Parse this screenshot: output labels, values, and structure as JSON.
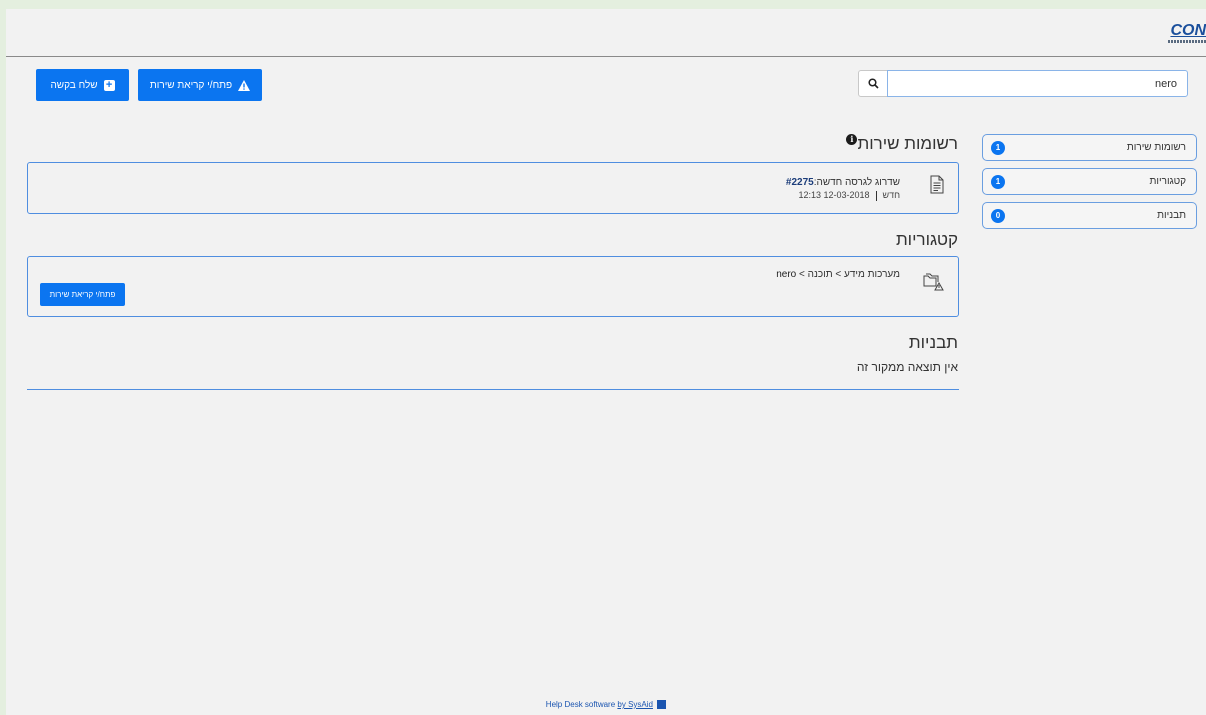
{
  "header": {
    "logo_text": "CON"
  },
  "toolbar": {
    "send_request_label": "שלח בקשה",
    "open_ticket_label": "פתח/י קריאת שירות",
    "search_value": "nero"
  },
  "sidebar": {
    "items": [
      {
        "label": "רשומות שירות",
        "count": "1"
      },
      {
        "label": "קטגוריות",
        "count": "1"
      },
      {
        "label": "תבניות",
        "count": "0"
      }
    ]
  },
  "main": {
    "service_records": {
      "title": "רשומות שירות",
      "info_icon": "i",
      "ticket": {
        "number": "#2275",
        "subject": "שדרוג לגרסה חדשה",
        "status": "חדש",
        "datetime": "12:13 12-03-2018"
      }
    },
    "categories": {
      "title": "קטגוריות",
      "path_prefix": "מערכות מידע > תוכנה > ",
      "path_keyword": "nero",
      "button_label": "פתח/י קריאת שירות"
    },
    "templates": {
      "title": "תבניות",
      "empty_message": "אין תוצאה ממקור זה"
    }
  },
  "footer": {
    "text": "Help Desk software ",
    "link": "by SysAid"
  },
  "colors": {
    "primary": "#0b75f0",
    "border": "#4f8ee0",
    "background": "#f2f2f2"
  }
}
